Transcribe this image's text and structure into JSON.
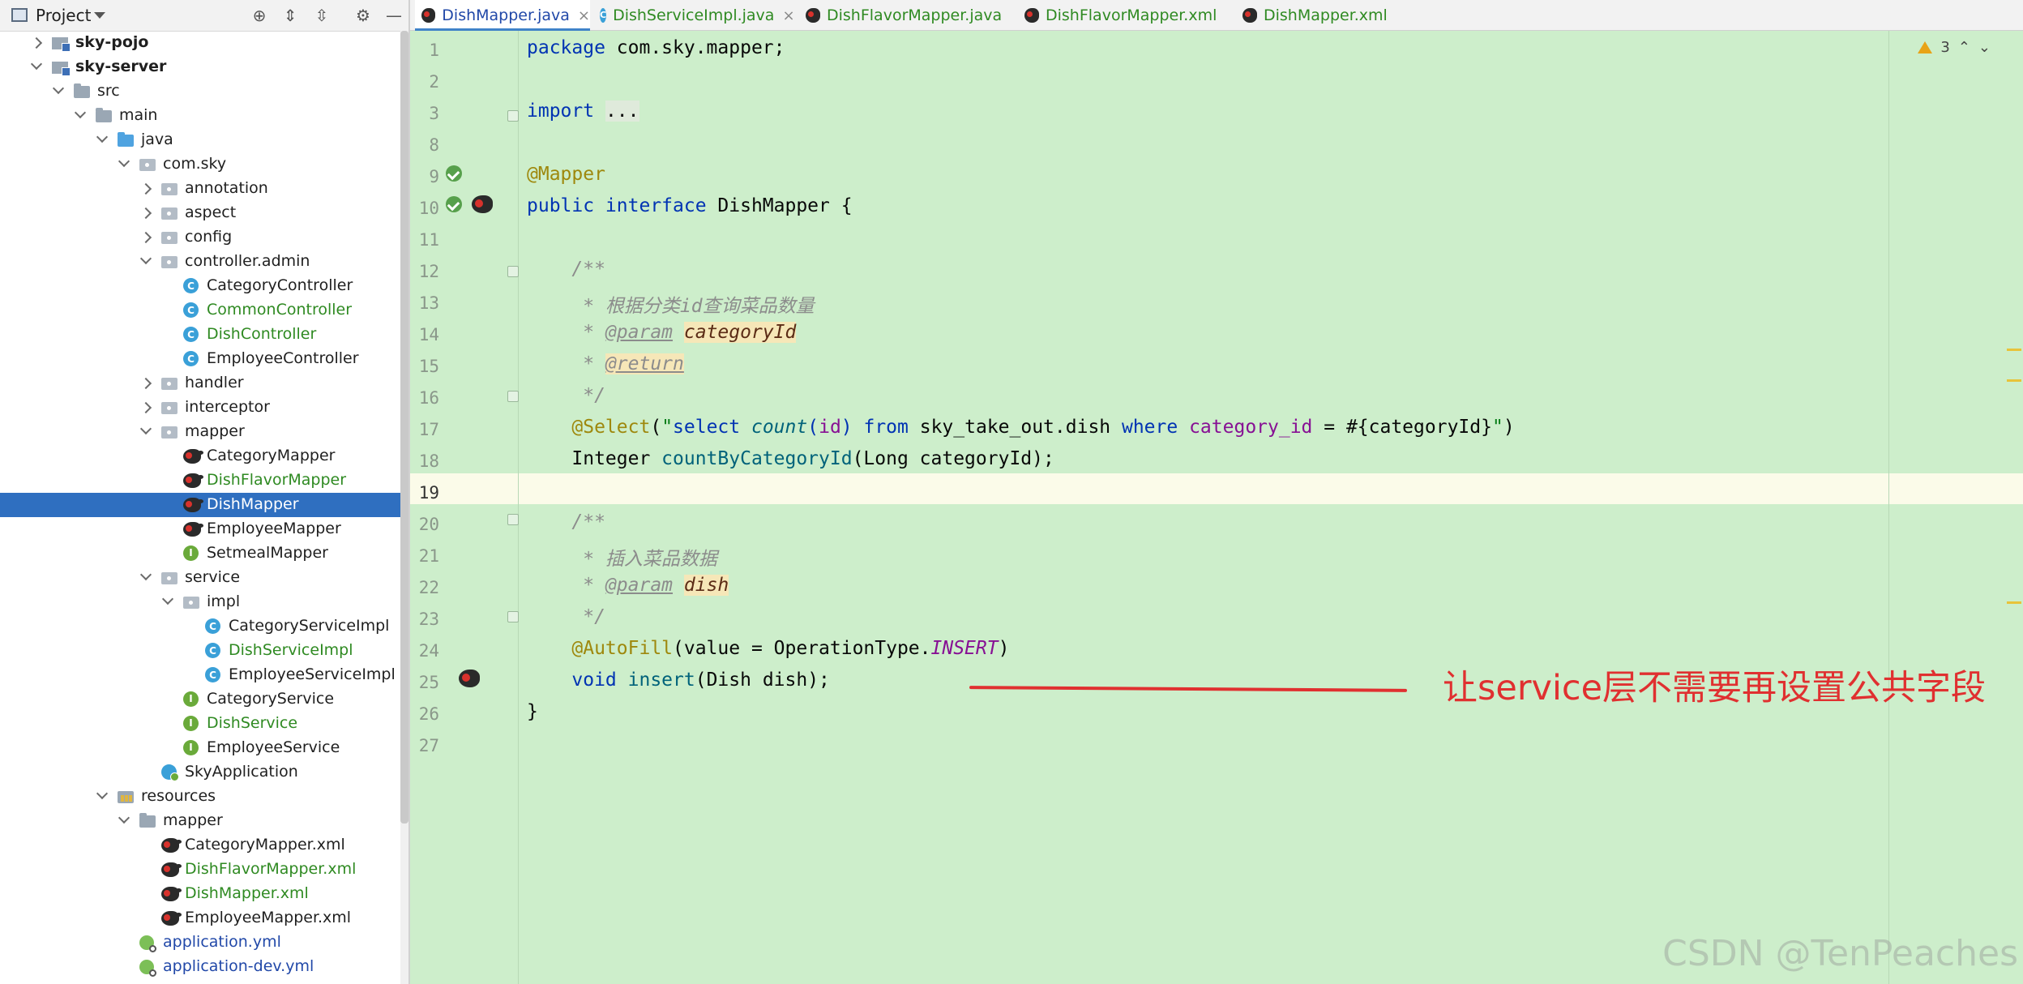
{
  "project": {
    "title": "Project"
  },
  "tree": [
    {
      "label": "sky-pojo",
      "kind": "module",
      "depth": 1,
      "arrow": "right",
      "bold": true
    },
    {
      "label": "sky-server",
      "kind": "module",
      "depth": 1,
      "arrow": "down",
      "bold": true
    },
    {
      "label": "src",
      "kind": "folder",
      "depth": 2,
      "arrow": "down"
    },
    {
      "label": "main",
      "kind": "folder",
      "depth": 3,
      "arrow": "down"
    },
    {
      "label": "java",
      "kind": "folder-blue",
      "depth": 4,
      "arrow": "down"
    },
    {
      "label": "com.sky",
      "kind": "pkg",
      "depth": 5,
      "arrow": "down"
    },
    {
      "label": "annotation",
      "kind": "pkg",
      "depth": 6,
      "arrow": "right"
    },
    {
      "label": "aspect",
      "kind": "pkg",
      "depth": 6,
      "arrow": "right"
    },
    {
      "label": "config",
      "kind": "pkg",
      "depth": 6,
      "arrow": "right"
    },
    {
      "label": "controller.admin",
      "kind": "pkg",
      "depth": 6,
      "arrow": "down"
    },
    {
      "label": "CategoryController",
      "kind": "cls",
      "depth": 7
    },
    {
      "label": "CommonController",
      "kind": "cls",
      "depth": 7,
      "color": "green"
    },
    {
      "label": "DishController",
      "kind": "cls",
      "depth": 7,
      "color": "green"
    },
    {
      "label": "EmployeeController",
      "kind": "cls",
      "depth": 7
    },
    {
      "label": "handler",
      "kind": "pkg",
      "depth": 6,
      "arrow": "right"
    },
    {
      "label": "interceptor",
      "kind": "pkg",
      "depth": 6,
      "arrow": "right"
    },
    {
      "label": "mapper",
      "kind": "pkg",
      "depth": 6,
      "arrow": "down"
    },
    {
      "label": "CategoryMapper",
      "kind": "bird",
      "depth": 7
    },
    {
      "label": "DishFlavorMapper",
      "kind": "bird",
      "depth": 7,
      "color": "green"
    },
    {
      "label": "DishMapper",
      "kind": "bird",
      "depth": 7,
      "selected": true
    },
    {
      "label": "EmployeeMapper",
      "kind": "bird",
      "depth": 7
    },
    {
      "label": "SetmealMapper",
      "kind": "intf",
      "depth": 7
    },
    {
      "label": "service",
      "kind": "pkg",
      "depth": 6,
      "arrow": "down"
    },
    {
      "label": "impl",
      "kind": "pkg",
      "depth": 7,
      "arrow": "down"
    },
    {
      "label": "CategoryServiceImpl",
      "kind": "cls",
      "depth": 8
    },
    {
      "label": "DishServiceImpl",
      "kind": "cls",
      "depth": 8,
      "color": "green"
    },
    {
      "label": "EmployeeServiceImpl",
      "kind": "cls",
      "depth": 8
    },
    {
      "label": "CategoryService",
      "kind": "intf",
      "depth": 7
    },
    {
      "label": "DishService",
      "kind": "intf",
      "depth": 7,
      "color": "green"
    },
    {
      "label": "EmployeeService",
      "kind": "intf",
      "depth": 7
    },
    {
      "label": "SkyApplication",
      "kind": "app",
      "depth": 6
    },
    {
      "label": "resources",
      "kind": "res",
      "depth": 4,
      "arrow": "down"
    },
    {
      "label": "mapper",
      "kind": "folder",
      "depth": 5,
      "arrow": "down"
    },
    {
      "label": "CategoryMapper.xml",
      "kind": "bird",
      "depth": 6
    },
    {
      "label": "DishFlavorMapper.xml",
      "kind": "bird",
      "depth": 6,
      "color": "green"
    },
    {
      "label": "DishMapper.xml",
      "kind": "bird",
      "depth": 6,
      "color": "green"
    },
    {
      "label": "EmployeeMapper.xml",
      "kind": "bird",
      "depth": 6
    },
    {
      "label": "application.yml",
      "kind": "yml",
      "depth": 5,
      "color": "blue"
    },
    {
      "label": "application-dev.yml",
      "kind": "yml",
      "depth": 5,
      "color": "blue"
    }
  ],
  "tabs": [
    {
      "label": "DishMapper.java",
      "icon": "bird",
      "active": true
    },
    {
      "label": "DishServiceImpl.java",
      "icon": "cls"
    },
    {
      "label": "DishFlavorMapper.java",
      "icon": "bird"
    },
    {
      "label": "DishFlavorMapper.xml",
      "icon": "bird"
    },
    {
      "label": "DishMapper.xml",
      "icon": "bird"
    }
  ],
  "editor": {
    "warnings": "3",
    "line_numbers": [
      "1",
      "2",
      "3",
      "8",
      "9",
      "10",
      "11",
      "12",
      "13",
      "14",
      "15",
      "16",
      "17",
      "18",
      "19",
      "20",
      "21",
      "22",
      "23",
      "24",
      "25",
      "26",
      "27"
    ],
    "current_line": "19"
  },
  "annotation": "让service层不需要再设置公共字段",
  "watermark": "CSDN @TenPeaches",
  "colors": {
    "selection": "#2f6fc0",
    "editor_bg": "#cdeecb",
    "annotation": "#e03030"
  },
  "icons": {
    "settings": "gear-icon",
    "minimize": "minimize-icon",
    "locate": "crosshair-icon"
  }
}
